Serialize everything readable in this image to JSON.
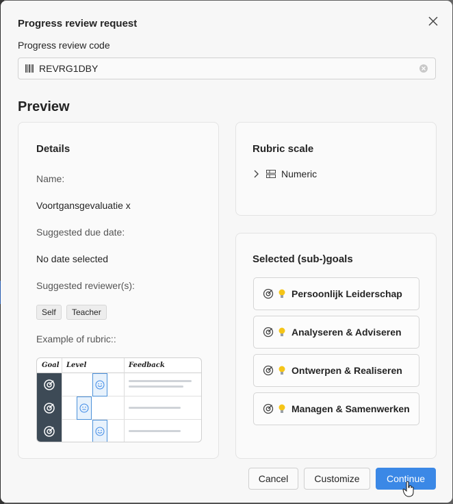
{
  "dialog": {
    "title": "Progress review request",
    "code_label": "Progress review code",
    "code_value": "REVRG1DBY",
    "preview_title": "Preview"
  },
  "details": {
    "heading": "Details",
    "name_label": "Name:",
    "name_value": "Voortgansgevaluatie x",
    "due_label": "Suggested due date:",
    "due_value": "No date selected",
    "reviewers_label": "Suggested reviewer(s):",
    "reviewers": [
      "Self",
      "Teacher"
    ],
    "rubric_example_label": "Example of rubric::",
    "rubric_headers": [
      "Goal",
      "Level",
      "Feedback"
    ]
  },
  "rubric_scale": {
    "heading": "Rubric scale",
    "item": "Numeric"
  },
  "goals": {
    "heading": "Selected (sub-)goals",
    "items": [
      "Persoonlijk Leiderschap",
      "Analyseren & Adviseren",
      "Ontwerpen & Realiseren",
      "Managen & Samenwerken"
    ]
  },
  "footer": {
    "cancel": "Cancel",
    "customize": "Customize",
    "continue": "Continue"
  },
  "colors": {
    "primary": "#3b88e6",
    "goal_column": "#3d4a56",
    "bulb": "#f5c518"
  },
  "icons": [
    "close-icon",
    "barcode-icon",
    "clear-icon",
    "chevron-right-icon",
    "scale-icon",
    "target-icon",
    "lightbulb-icon"
  ]
}
